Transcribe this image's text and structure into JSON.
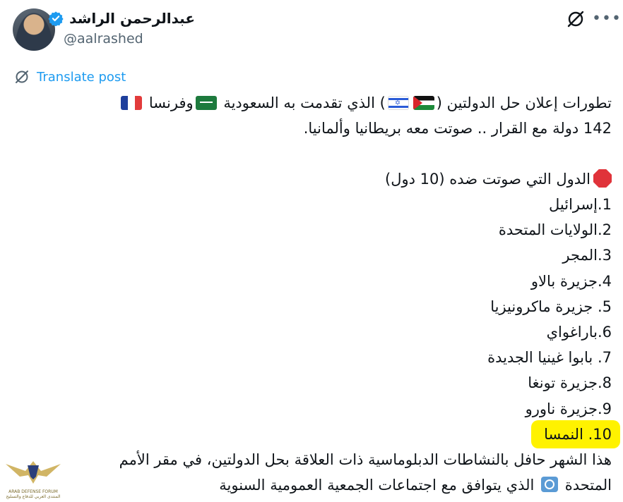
{
  "author": {
    "display_name": "عبدالرحمن الراشد",
    "handle": "@aalrashed",
    "verified": true
  },
  "header_icons": [
    "grok-icon",
    "more-icon"
  ],
  "translate": {
    "label": "Translate post",
    "icon": "translate-icon"
  },
  "post": {
    "line1_a": "تطورات إعلان  حل الدولتين (",
    "line1_b": ") الذي تقدمت به السعودية ",
    "line1_c": "وفرنسا ",
    "line2": "142 دولة مع القرار .. صوتت معه بريطانيا وألمانيا.",
    "against_heading": "الدول التي صوتت ضده (10 دول)",
    "against_list": [
      "1.إسرائيل",
      "2.الولايات المتحدة",
      "3.المجر",
      "4.جزيرة بالاو",
      "5. جزيرة ماكرونيزيا",
      "6.باراغواي",
      "7. بابوا غينيا الجديدة",
      "8.جزيرة تونغا",
      "9.جزيرة ناورو",
      "10. النمسا"
    ],
    "closing_line1": "هذا الشهر حافل بالنشاطات الدبلوماسية ذات العلاقة بحل الدولتين، في مقر الأمم",
    "closing_line2_a": "المتحدة ",
    "closing_line2_b": " الذي يتوافق مع اجتماعات الجمعية العمومية السنوية"
  },
  "flags": [
    "flag-palestine",
    "flag-israel",
    "flag-saudi-arabia",
    "flag-france",
    "flag-united-nations"
  ],
  "watermark": {
    "line1": "ARAB DEFENSE FORUM",
    "line2": "المنتدى العربي للدفاع والتسليح"
  },
  "colors": {
    "link_blue": "#1d9bf0",
    "verified_blue": "#1d9bf0",
    "highlight_yellow": "#fff200",
    "text": "#0f1419",
    "muted": "#536471"
  }
}
